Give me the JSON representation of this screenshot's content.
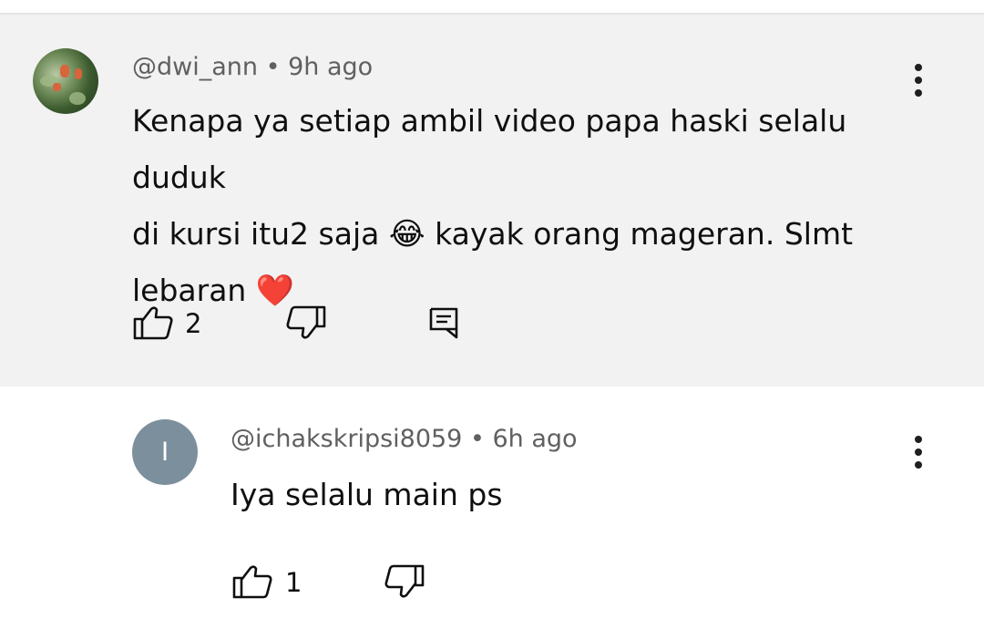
{
  "comments": [
    {
      "author": "@dwi_ann",
      "time": "9h ago",
      "text_line1": "Kenapa ya setiap ambil video papa haski selalu duduk",
      "text_line2_a": "di kursi itu2 saja",
      "emoji_laugh": "😂",
      "text_line2_b": "kayak orang mageran. Slmt",
      "text_line3": "lebaran",
      "emoji_heart": "❤️",
      "like_count": "2"
    },
    {
      "author": "@ichakskripsi8059",
      "time": "6h ago",
      "avatar_letter": "I",
      "text": "Iya selalu main ps",
      "like_count": "1"
    }
  ],
  "separator": "•",
  "icons": [
    "thumbs-up-icon",
    "thumbs-down-icon",
    "reply-icon",
    "more-vert-icon"
  ],
  "colors": {
    "highlight_bg": "#f2f2f2",
    "meta_text": "#606060",
    "avatar_letter_bg": "#7c8f9c"
  }
}
